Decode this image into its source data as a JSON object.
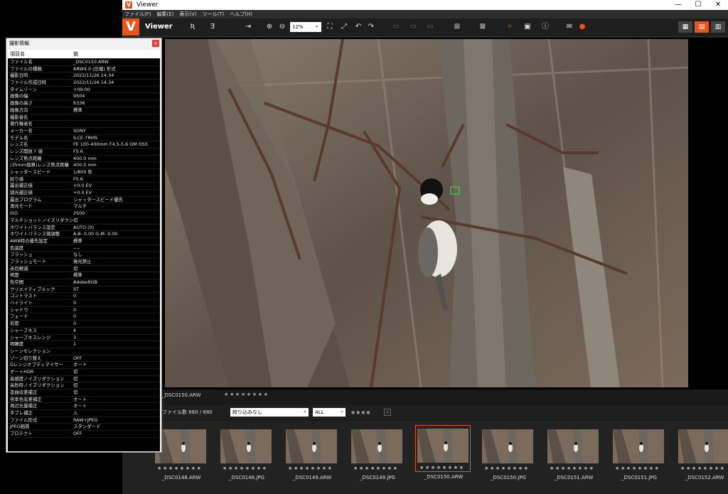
{
  "window": {
    "title": "Viewer",
    "logo": "V"
  },
  "window_controls": {
    "minimize": "—",
    "maximize": "☐",
    "close": "✕"
  },
  "menu": [
    "ファイル(F)",
    "編集(E)",
    "表示(V)",
    "ツール(T)",
    "ヘルプ(H)"
  ],
  "toolbar": {
    "title": "Viewer",
    "zoom": "12%",
    "icons": [
      "r-icon",
      "e-icon",
      "export-icon",
      "zoom-in-icon",
      "zoom-out-icon",
      "fit-icon",
      "actual-size-icon",
      "rotate-left-icon",
      "rotate-right-icon",
      "compare-icon",
      "grid-icon",
      "crop-icon",
      "image-icon",
      "info-icon",
      "mail-icon"
    ]
  },
  "image": {
    "filename": "_DSC0150.ARW"
  },
  "filterbar": {
    "count_label": "ファイル数 680 / 680",
    "filter": "絞り込みなし",
    "rating": "ALL"
  },
  "thumbnails": [
    {
      "name": "_DSC0148.ARW"
    },
    {
      "name": "_DSC0148.JPG"
    },
    {
      "name": "_DSC0149.ARW"
    },
    {
      "name": "_DSC0149.JPG"
    },
    {
      "name": "_DSC0150.ARW"
    },
    {
      "name": "_DSC0150.JPG"
    },
    {
      "name": "_DSC0151.ARW"
    },
    {
      "name": "_DSC0151.JPG"
    },
    {
      "name": "_DSC0152.ARW"
    }
  ],
  "info_dialog": {
    "title": "撮影情報",
    "header": {
      "k": "項目名",
      "v": "値"
    },
    "rows": [
      {
        "k": "ファイル名",
        "v": "_DSC0150.ARW"
      },
      {
        "k": "ファイルの種類",
        "v": "ARW4.0 (圧縮) 形式"
      },
      {
        "k": "撮影日時",
        "v": "2022/11/26 14:34"
      },
      {
        "k": "ファイル作成日時",
        "v": "2022/11/26 14:34"
      },
      {
        "k": "タイムゾーン",
        "v": "+09:00"
      },
      {
        "k": "画像の幅",
        "v": "9504"
      },
      {
        "k": "画像の高さ",
        "v": "6336"
      },
      {
        "k": "画像方向",
        "v": "標準"
      },
      {
        "k": "撮影者名",
        "v": ""
      },
      {
        "k": "著作権者名",
        "v": ""
      },
      {
        "k": "メーカー名",
        "v": "SONY"
      },
      {
        "k": "モデル名",
        "v": "ILCE-7RM5"
      },
      {
        "k": "レンズ名",
        "v": "FE 100-400mm F4.5-5.6 GM OSS"
      },
      {
        "k": "レンズ開放 F 値",
        "v": "F5.6"
      },
      {
        "k": "レンズ焦点距離",
        "v": "400.0 mm"
      },
      {
        "k": "(35mm換算)レンズ焦点距離",
        "v": "400.0 mm"
      },
      {
        "k": "シャッタースピード",
        "v": "1/800 秒"
      },
      {
        "k": "絞り値",
        "v": "F5.6"
      },
      {
        "k": "露出補正値",
        "v": "+0.0 EV"
      },
      {
        "k": "調光補正値",
        "v": "+0.0 EV"
      },
      {
        "k": "露出プログラム",
        "v": "シャッタースピード優先"
      },
      {
        "k": "測光モード",
        "v": "マルチ"
      },
      {
        "k": "ISO",
        "v": "2500"
      },
      {
        "k": "マルチショットノイズリダクション",
        "v": "切"
      },
      {
        "k": "ホワイトバランス設定",
        "v": "AUTO (0)"
      },
      {
        "k": "ホワイトバランス微調整",
        "v": "A-B: 0.00 G-M: 0.00"
      },
      {
        "k": "AWB時の優先設定",
        "v": "標準"
      },
      {
        "k": "色温度",
        "v": "----"
      },
      {
        "k": "フラッシュ",
        "v": "なし"
      },
      {
        "k": "フラッシュモード",
        "v": "発光禁止"
      },
      {
        "k": "赤目軽減",
        "v": "切"
      },
      {
        "k": "明度",
        "v": "標準"
      },
      {
        "k": "色空間",
        "v": "AdobeRGB"
      },
      {
        "k": "クリエイティブルック",
        "v": "ST"
      },
      {
        "k": "コントラスト",
        "v": "0"
      },
      {
        "k": "ハイライト",
        "v": "0"
      },
      {
        "k": "シャドウ",
        "v": "0"
      },
      {
        "k": "フェード",
        "v": "0"
      },
      {
        "k": "彩度",
        "v": "0"
      },
      {
        "k": "シャープネス",
        "v": "4"
      },
      {
        "k": "シャープネスレンジ",
        "v": "3"
      },
      {
        "k": "明瞭度",
        "v": "1"
      },
      {
        "k": "シーンセレクション",
        "v": ""
      },
      {
        "k": "ゾーン切り替え",
        "v": "OFF"
      },
      {
        "k": "Dレンジオプティマイザー",
        "v": "オート"
      },
      {
        "k": "オートHDR",
        "v": "切"
      },
      {
        "k": "高感度ノイズリダクション",
        "v": "切"
      },
      {
        "k": "長秒時ノイズリダクション",
        "v": "切"
      },
      {
        "k": "歪曲収差補正",
        "v": "切"
      },
      {
        "k": "倍率色収差補正",
        "v": "オート"
      },
      {
        "k": "周辺光量補正",
        "v": "オート"
      },
      {
        "k": "手ブレ補正",
        "v": "入"
      },
      {
        "k": "ファイル形式",
        "v": "RAW+JPEG"
      },
      {
        "k": "JPEG画質",
        "v": "スタンダード"
      },
      {
        "k": "プロテクト",
        "v": "OFF"
      }
    ]
  },
  "colors": {
    "accent": "#e8541a"
  }
}
